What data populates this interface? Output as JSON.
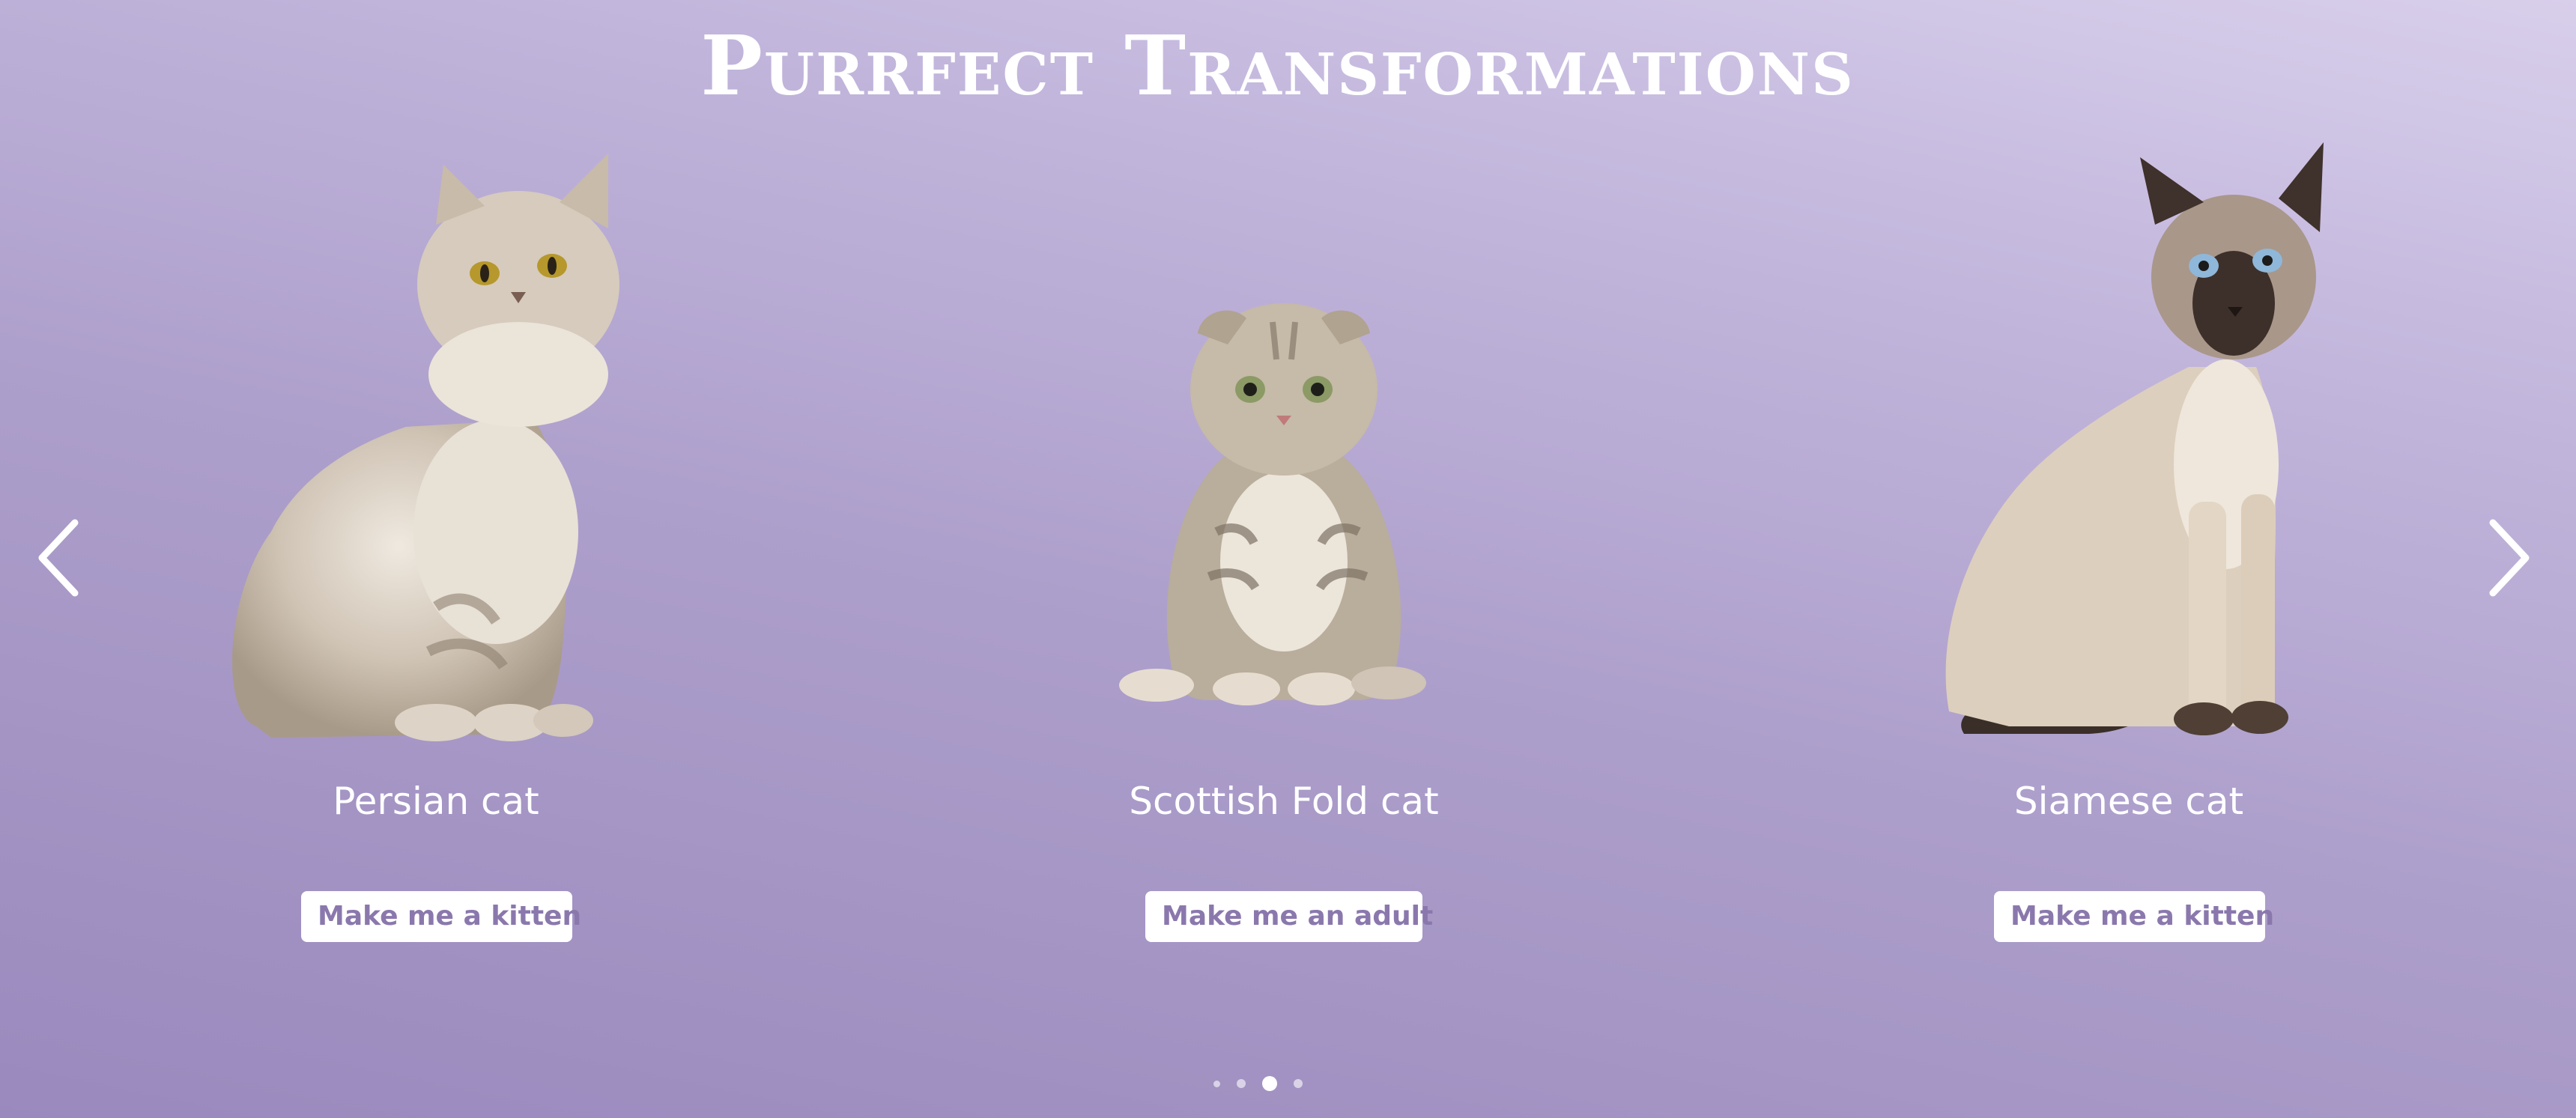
{
  "page": {
    "title": "Purrfect Transformations"
  },
  "carousel": {
    "prev_icon": "chevron-left-icon",
    "next_icon": "chevron-right-icon",
    "active_dot": 3,
    "dot_count": 4,
    "cards": [
      {
        "name": "Persian cat",
        "button_label": "Make me a kitten",
        "image": "persian-cat-image"
      },
      {
        "name": "Scottish Fold cat",
        "button_label": "Make me an adult",
        "image": "scottish-fold-kitten-image"
      },
      {
        "name": "Siamese cat",
        "button_label": "Make me a kitten",
        "image": "siamese-cat-image"
      }
    ]
  },
  "colors": {
    "background_start": "#9a89bd",
    "background_end": "#d8cfeb",
    "button_text": "#8a78ad",
    "button_bg": "#ffffff"
  }
}
